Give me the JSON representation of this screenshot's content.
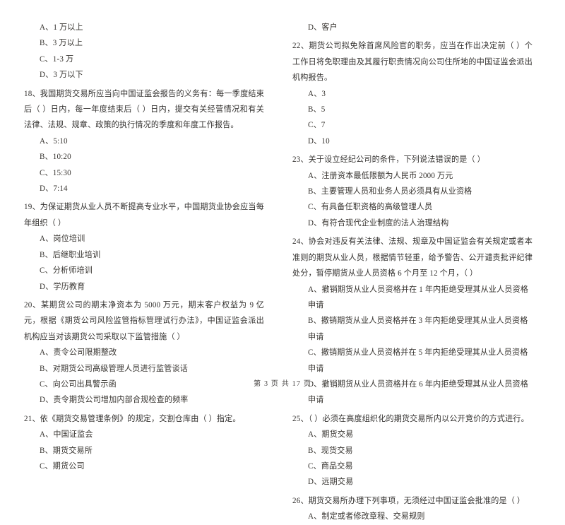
{
  "document": {
    "type": "exam-paper",
    "language": "zh-CN",
    "footer": "第 3 页  共 17 页"
  },
  "left_column": {
    "orphan_options": [
      "A、1 万以上",
      "B、3 万以上",
      "C、1-3 万",
      "D、3 万以下"
    ],
    "questions": [
      {
        "number": "18",
        "stem": "18、我国期货交易所应当向中国证监会报告的义务有：每一季度结束后（      ）日内，每一年度结束后（      ）日内，提交有关经营情况和有关法律、法规、规章、政策的执行情况的季度和年度工作报告。",
        "options": [
          "A、5:10",
          "B、10:20",
          "C、15:30",
          "D、7:14"
        ]
      },
      {
        "number": "19",
        "stem": "19、为保证期货从业人员不断提高专业水平，中国期货业协会应当每年组织（      ）",
        "options": [
          "A、岗位培训",
          "B、后继职业培训",
          "C、分析师培训",
          "D、学历教育"
        ]
      },
      {
        "number": "20",
        "stem": "20、某期货公司的期末净资本为 5000 万元，期末客户权益为 9 亿元，根据《期货公司风险监管指标管理试行办法》，中国证监会派出机构应当对该期货公司采取以下监管措施（      ）",
        "options": [
          "A、责令公司限期整改",
          "B、对期货公司高级管理人员进行监管谈话",
          "C、向公司出具警示函",
          "D、责令期货公司增加内部合规检查的频率"
        ]
      },
      {
        "number": "21",
        "stem": "21、依《期货交易管理条例》的规定，交割仓库由（      ）指定。",
        "options": [
          "A、中国证监会",
          "B、期货交易所",
          "C、期货公司"
        ]
      }
    ]
  },
  "right_column": {
    "orphan_options": [
      "D、客户"
    ],
    "questions": [
      {
        "number": "22",
        "stem": "22、期货公司拟免除首席风险官的职务，应当在作出决定前（      ）个工作日将免职理由及其履行职责情况向公司住所地的中国证监会派出机构报告。",
        "options": [
          "A、3",
          "B、5",
          "C、7",
          "D、10"
        ]
      },
      {
        "number": "23",
        "stem": "23、关于设立经纪公司的条件，下列说法错误的是（      ）",
        "options": [
          "A、注册资本最低限额为人民币 2000 万元",
          "B、主要管理人员和业务人员必须具有从业资格",
          "C、有具备任职资格的高级管理人员",
          "D、有符合现代企业制度的法人治理结构"
        ]
      },
      {
        "number": "24",
        "stem": "24、协会对违反有关法律、法规、规章及中国证监会有关规定或者本准则的期货从业人员，根据情节轻重，给予警告、公开谴责批评纪律处分，暂停期货从业人员资格 6 个月至 12 个月，（      ）",
        "options": [
          "A、撤销期货从业人员资格并在 1 年内拒绝受理其从业人员资格申请",
          "B、撤销期货从业人员资格并在 3 年内拒绝受理其从业人员资格申请",
          "C、撤销期货从业人员资格并在 5 年内拒绝受理其从业人员资格申请",
          "D、撤销期货从业人员资格并在 6 年内拒绝受理其从业人员资格申请"
        ]
      },
      {
        "number": "25",
        "stem": "25、（      ）必须在高度组织化的期货交易所内以公开竞价的方式进行。",
        "options": [
          "A、期货交易",
          "B、现货交易",
          "C、商品交易",
          "D、远期交易"
        ]
      },
      {
        "number": "26",
        "stem": "26、期货交易所办理下列事项，无须经过中国证监会批准的是（      ）",
        "options": [
          "A、制定或者修改章程、交易规则"
        ]
      }
    ]
  }
}
